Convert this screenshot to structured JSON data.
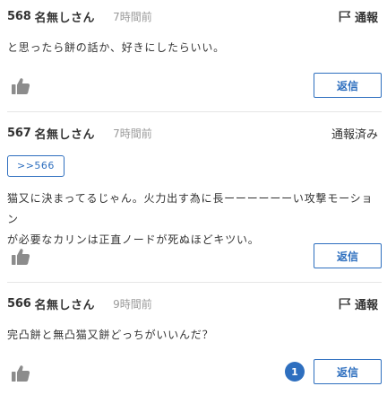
{
  "posts": [
    {
      "number": "568",
      "name": "名無しさん",
      "time": "7時間前",
      "report_label": "通報",
      "report_state": "flag",
      "lines": [
        "と思ったら餅の話か、好きにしたらいい。"
      ],
      "reply_label": "返信"
    },
    {
      "number": "567",
      "name": "名無しさん",
      "time": "7時間前",
      "report_label": "通報済み",
      "report_state": "done",
      "anchor": ">>566",
      "lines": [
        "猫又に決まってるじゃん。火力出す為に長ーーーーーーい攻撃モーション",
        "が必要なカリンは正直ノードが死ぬほどキツい。"
      ],
      "reply_label": "返信"
    },
    {
      "number": "566",
      "name": "名無しさん",
      "time": "9時間前",
      "report_label": "通報",
      "report_state": "flag",
      "lines": [
        "完凸餅と無凸猫又餅どっちがいいんだ？"
      ],
      "reply_label": "返信",
      "reply_count": "1"
    }
  ],
  "icons": {
    "flag": "flag-icon",
    "like": "thumbs-up-icon"
  },
  "colors": {
    "accent": "#2e6fbf",
    "muted": "#9a9a9a",
    "icon_gray": "#8c8c8c"
  }
}
